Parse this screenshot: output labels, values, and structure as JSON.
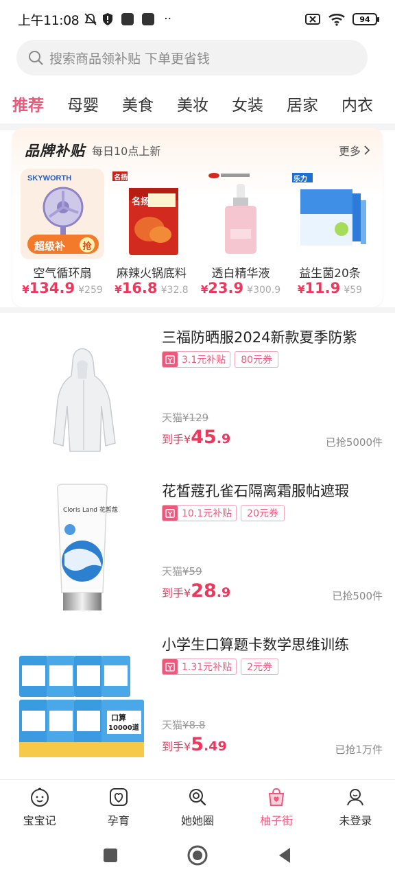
{
  "status_bar": {
    "time": "上午11:08",
    "battery": "94"
  },
  "search": {
    "placeholder": "搜索商品领补贴 下单更省钱"
  },
  "tabs": [
    {
      "label": "推荐",
      "active": true
    },
    {
      "label": "母婴"
    },
    {
      "label": "美食"
    },
    {
      "label": "美妆"
    },
    {
      "label": "女装"
    },
    {
      "label": "居家"
    },
    {
      "label": "内衣"
    }
  ],
  "brand_section": {
    "title": "品牌补贴",
    "subtitle": "每日10点上新",
    "more": "更多",
    "products": [
      {
        "name": "空气循环扇",
        "currency": "¥",
        "price": "134.9",
        "original": "¥259",
        "brand": "SKYWORTH",
        "badge": "超级补",
        "badge_icon": "抢"
      },
      {
        "name": "麻辣火锅底料",
        "currency": "¥",
        "price": "16.8",
        "original": "¥32.8",
        "brand": "名扬"
      },
      {
        "name": "透白精华液",
        "currency": "¥",
        "price": "23.9",
        "original": "¥300.9"
      },
      {
        "name": "益生菌20条",
        "currency": "¥",
        "price": "11.9",
        "original": "¥59",
        "brand": "乐力"
      }
    ]
  },
  "products": [
    {
      "title": "三福防晒服2024新款夏季防紫",
      "subsidy": "3.1元补贴",
      "coupon": "80元券",
      "orig_label": "天猫",
      "orig_price": "¥129",
      "final_label": "到手",
      "final_currency": "¥",
      "final_int": "45",
      "final_dec": ".9",
      "sold": "已抢5000件"
    },
    {
      "title": "花皙蔻孔雀石隔离霜服帖遮瑕",
      "subsidy": "10.1元补贴",
      "coupon": "20元券",
      "orig_label": "天猫",
      "orig_price": "¥59",
      "final_label": "到手",
      "final_currency": "¥",
      "final_int": "28",
      "final_dec": ".9",
      "sold": "已抢500件"
    },
    {
      "title": "小学生口算题卡数学思维训练",
      "subsidy": "1.31元补贴",
      "coupon": "2元券",
      "orig_label": "天猫",
      "orig_price": "¥8.8",
      "final_label": "到手",
      "final_currency": "¥",
      "final_int": "5",
      "final_dec": ".49",
      "sold": "已抢1万件"
    }
  ],
  "product_images": {
    "cream_brand": "Cloris Land 花皙蔻",
    "book_text": "口算",
    "book_count": "10000道"
  },
  "bottom_nav": [
    {
      "label": "宝宝记",
      "icon": "baby-face-icon"
    },
    {
      "label": "孕育",
      "icon": "heart-leaf-icon"
    },
    {
      "label": "她她圈",
      "icon": "search-circle-icon"
    },
    {
      "label": "柚子街",
      "icon": "shopping-bag-icon",
      "active": true
    },
    {
      "label": "未登录",
      "icon": "user-icon"
    }
  ],
  "colors": {
    "accent": "#f0587b",
    "price": "#f0365b"
  }
}
